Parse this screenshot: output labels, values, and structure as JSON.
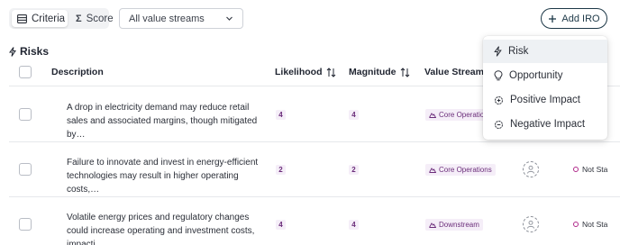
{
  "toolbar": {
    "tabs": [
      {
        "label": "Criteria",
        "icon": "table-icon",
        "active": true
      },
      {
        "label": "Score",
        "icon": "sigma-icon",
        "active": false
      }
    ],
    "filter": {
      "selected": "All value streams"
    },
    "add_button": {
      "label": "Add IRO"
    }
  },
  "section": {
    "title": "Risks",
    "icon": "bolt-icon"
  },
  "table": {
    "headers": {
      "description": "Description",
      "likelihood": "Likelihood",
      "magnitude": "Magnitude",
      "value_stream": "Value Stream"
    },
    "rows": [
      {
        "description": "A drop in electricity demand may reduce retail sales and associated margins, though mitigated by…",
        "likelihood": "4",
        "magnitude": "4",
        "value_stream": "Core Operations",
        "status": ""
      },
      {
        "description": "Failure to innovate and invest in energy-efficient technologies may result in higher operating costs,…",
        "likelihood": "2",
        "magnitude": "2",
        "value_stream": "Core Operations",
        "status": "Not Sta"
      },
      {
        "description": "Volatile energy prices and regulatory changes could increase operating and investment costs, impacti…",
        "likelihood": "4",
        "magnitude": "4",
        "value_stream": "Downstream",
        "status": "Not Sta"
      }
    ]
  },
  "menu": {
    "items": [
      {
        "label": "Risk",
        "icon": "bolt-icon",
        "highlighted": true
      },
      {
        "label": "Opportunity",
        "icon": "lightbulb-icon",
        "highlighted": false
      },
      {
        "label": "Positive Impact",
        "icon": "gear-plus-icon",
        "highlighted": false
      },
      {
        "label": "Negative Impact",
        "icon": "gear-minus-icon",
        "highlighted": false
      }
    ]
  },
  "colors": {
    "accent": "#1d3847",
    "badge_bg": "#f5eef8",
    "badge_text": "#6b2d7a",
    "status_dot": "#b0288a",
    "menu_highlight": "#eef1f4"
  }
}
